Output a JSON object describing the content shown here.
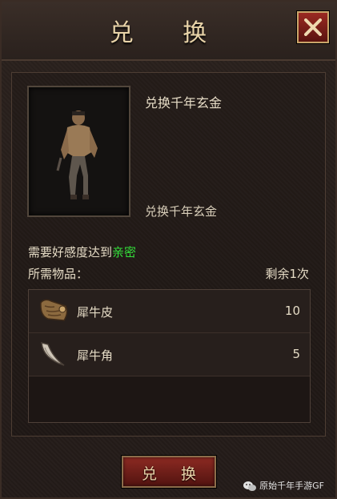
{
  "dialog": {
    "title": "兑 换",
    "item_name": "兑换千年玄金",
    "item_description": "兑换千年玄金",
    "requirement_prefix": "需要好感度达到",
    "requirement_level": "亲密",
    "needed_label": "所需物品：",
    "remaining": "剩余1次",
    "materials": [
      {
        "name": "犀牛皮",
        "quantity": "10",
        "icon": "rhino-hide-icon"
      },
      {
        "name": "犀牛角",
        "quantity": "5",
        "icon": "rhino-horn-icon"
      }
    ],
    "exchange_button": "兑 换"
  },
  "watermark": {
    "text": "原始千年手游GF",
    "icon": "wechat-icon"
  },
  "colors": {
    "highlight": "#33e03a",
    "text": "#e6dcc6",
    "title": "#e8d3a8",
    "button": "#8c2a22"
  }
}
